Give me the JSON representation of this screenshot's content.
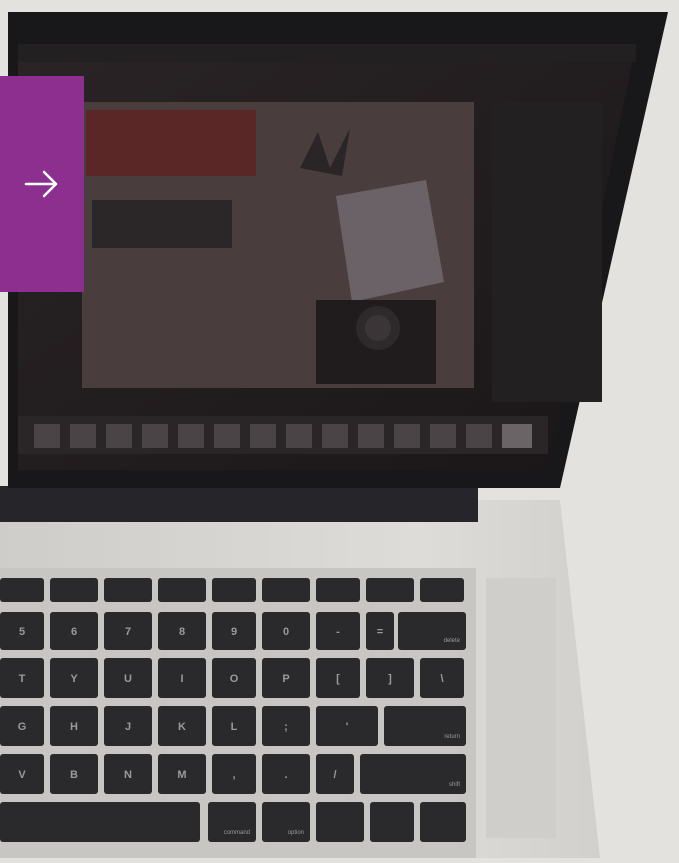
{
  "photo": {
    "subject": "laptop-on-desk",
    "screen_content": "photo-of-workspace",
    "colors": {
      "background": "#e4e2df",
      "laptop_body": "#d6d4d1",
      "bezel": "#1b1b1d",
      "keys": "#2a2a2c",
      "key_label": "#9a9a9a"
    }
  },
  "nav": {
    "next_icon": "arrow-right-icon",
    "accent_color": "#8c2f8f"
  },
  "keyboard": {
    "rows": [
      [
        "",
        "",
        "",
        "",
        "",
        "",
        "",
        "",
        "",
        ""
      ],
      [
        "5",
        "6",
        "7",
        "8",
        "9",
        "0",
        "-",
        "=",
        "delete"
      ],
      [
        "T",
        "Y",
        "U",
        "I",
        "O",
        "P",
        "[",
        "]",
        "\\"
      ],
      [
        "G",
        "H",
        "J",
        "K",
        "L",
        ";",
        "'",
        "return"
      ],
      [
        "V",
        "B",
        "N",
        "M",
        ",",
        ".",
        "/",
        "shift"
      ],
      [
        "",
        "command",
        "option",
        "",
        "",
        ""
      ]
    ]
  }
}
